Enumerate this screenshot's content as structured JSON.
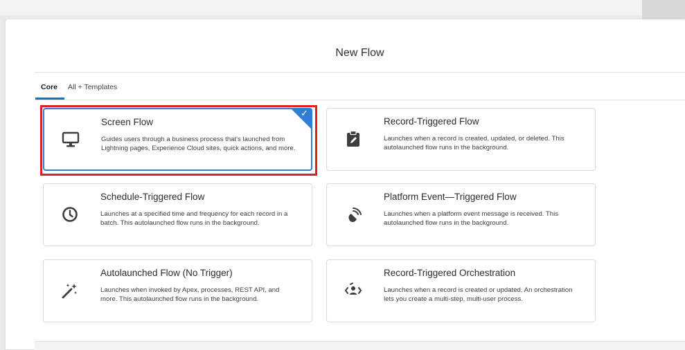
{
  "modal": {
    "title": "New Flow"
  },
  "tabs": [
    {
      "label": "Core",
      "active": true
    },
    {
      "label": "All + Templates",
      "active": false
    }
  ],
  "cards": [
    {
      "title": "Screen Flow",
      "description": "Guides users through a business process that's launched from Lightning pages, Experience Cloud sites, quick actions, and more.",
      "icon": "desktop-icon",
      "selected": true
    },
    {
      "title": "Record-Triggered Flow",
      "description": "Launches when a record is created, updated, or deleted. This autolaunched flow runs in the background.",
      "icon": "clipboard-edit-icon",
      "selected": false
    },
    {
      "title": "Schedule-Triggered Flow",
      "description": "Launches at a specified time and frequency for each record in a batch. This autolaunched flow runs in the background.",
      "icon": "clock-icon",
      "selected": false
    },
    {
      "title": "Platform Event—Triggered Flow",
      "description": "Launches when a platform event message is received. This autolaunched flow runs in the background.",
      "icon": "signal-icon",
      "selected": false
    },
    {
      "title": "Autolaunched Flow (No Trigger)",
      "description": "Launches when invoked by Apex, processes, REST API, and more. This autolaunched flow runs in the background.",
      "icon": "magic-wand-icon",
      "selected": false
    },
    {
      "title": "Record-Triggered Orchestration",
      "description": "Launches when a record is created or updated. An orchestration lets you create a multi-step, multi-user process.",
      "icon": "orchestration-icon",
      "selected": false
    }
  ],
  "colors": {
    "accent": "#0176d3",
    "selected_border": "#2e7dd7",
    "highlight": "#e02020",
    "icon": "#3e3e3c"
  }
}
